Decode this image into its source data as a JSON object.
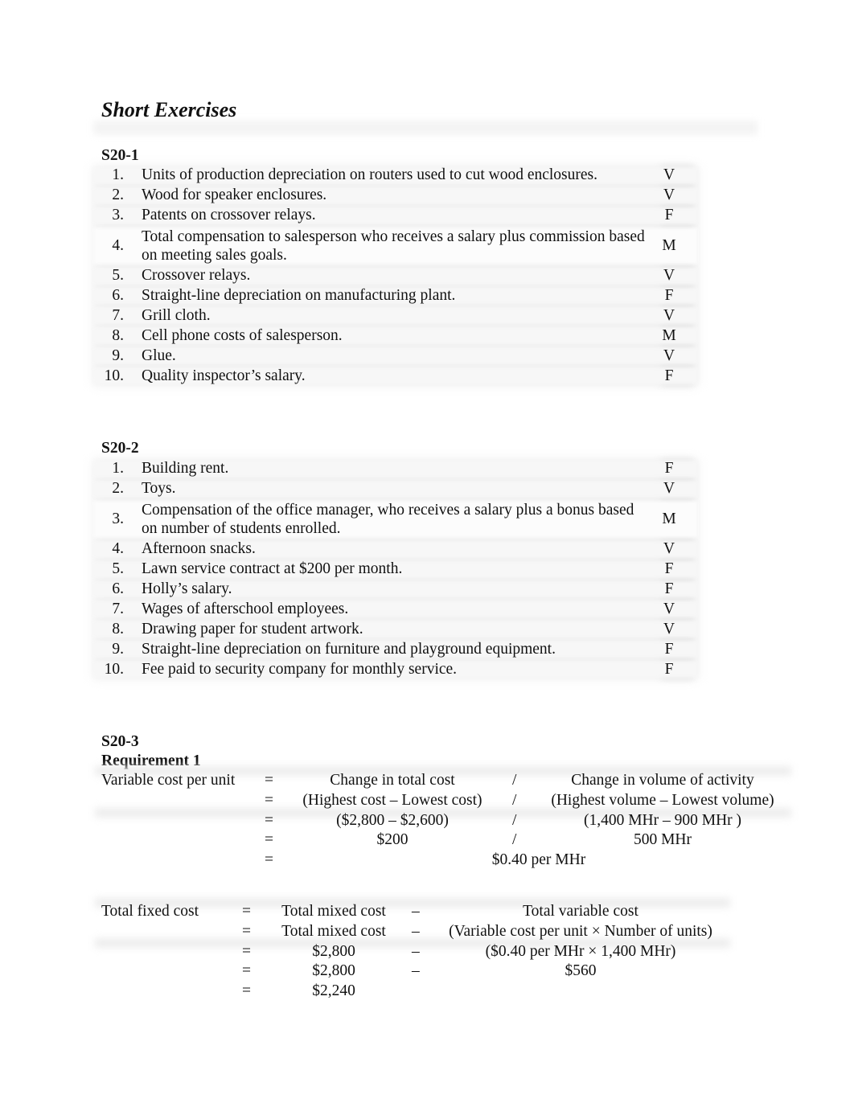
{
  "page": {
    "title": "Short Exercises"
  },
  "s20_1": {
    "heading": "S20-1",
    "items": [
      {
        "num": "1.",
        "desc": "Units of production depreciation on routers used to cut wood enclosures.",
        "answer": "V"
      },
      {
        "num": "2.",
        "desc": "Wood for speaker enclosures.",
        "answer": "V"
      },
      {
        "num": "3.",
        "desc": "Patents on crossover relays.",
        "answer": "F"
      },
      {
        "num": "4.",
        "desc": "Total compensation to salesperson who receives a salary plus commission based on meeting sales goals.",
        "answer": "M"
      },
      {
        "num": "5.",
        "desc": "Crossover relays.",
        "answer": "V"
      },
      {
        "num": "6.",
        "desc": "Straight-line depreciation on manufacturing plant.",
        "answer": "F"
      },
      {
        "num": "7.",
        "desc": "Grill cloth.",
        "answer": "V"
      },
      {
        "num": "8.",
        "desc": "Cell phone costs of salesperson.",
        "answer": "M"
      },
      {
        "num": "9.",
        "desc": "Glue.",
        "answer": "V"
      },
      {
        "num": "10.",
        "desc": "Quality inspector’s salary.",
        "answer": "F"
      }
    ]
  },
  "s20_2": {
    "heading": "S20-2",
    "items": [
      {
        "num": "1.",
        "desc": "Building rent.",
        "answer": "F"
      },
      {
        "num": "2.",
        "desc": "Toys.",
        "answer": "V"
      },
      {
        "num": "3.",
        "desc": "Compensation of the office manager, who receives a salary plus a bonus based on number of students enrolled.",
        "answer": "M"
      },
      {
        "num": "4.",
        "desc": "Afternoon snacks.",
        "answer": "V"
      },
      {
        "num": "5.",
        "desc": "Lawn service contract at $200 per month.",
        "answer": "F"
      },
      {
        "num": "6.",
        "desc": "Holly’s salary.",
        "answer": "F"
      },
      {
        "num": "7.",
        "desc": "Wages of afterschool employees.",
        "answer": "V"
      },
      {
        "num": "8.",
        "desc": "Drawing paper for student artwork.",
        "answer": "V"
      },
      {
        "num": "9.",
        "desc": "Straight-line depreciation on furniture and playground equipment.",
        "answer": "F"
      },
      {
        "num": "10.",
        "desc": "Fee paid to security company for monthly service.",
        "answer": "F"
      }
    ]
  },
  "s20_3": {
    "heading": "S20-3",
    "requirement": "Requirement 1",
    "variable_cost": {
      "label": "Variable cost per unit",
      "rows": [
        {
          "eq": "=",
          "left": "Change in total cost",
          "op": "/",
          "right": "Change in volume of activity"
        },
        {
          "eq": "=",
          "left": "(Highest cost – Lowest cost)",
          "op": "/",
          "right": "(Highest volume – Lowest volume)"
        },
        {
          "eq": "=",
          "left": "($2,800 – $2,600)",
          "op": "/",
          "right": "(1,400 MHr – 900 MHr )"
        },
        {
          "eq": "=",
          "left": "$200",
          "op": "/",
          "right": "500 MHr"
        }
      ],
      "result_eq": "=",
      "result": "$0.40 per MHr"
    },
    "fixed_cost": {
      "label": "Total fixed cost",
      "rows": [
        {
          "eq": "=",
          "left": "Total mixed cost",
          "op": "–",
          "right": "Total variable cost"
        },
        {
          "eq": "=",
          "left": "Total mixed cost",
          "op": "–",
          "right": "(Variable cost per unit × Number of units)"
        },
        {
          "eq": "=",
          "left": "$2,800",
          "op": "–",
          "right": "($0.40 per MHr × 1,400 MHr)"
        },
        {
          "eq": "=",
          "left": "$2,800",
          "op": "–",
          "right": "$560"
        },
        {
          "eq": "=",
          "left": "$2,240",
          "op": "",
          "right": ""
        }
      ]
    }
  }
}
